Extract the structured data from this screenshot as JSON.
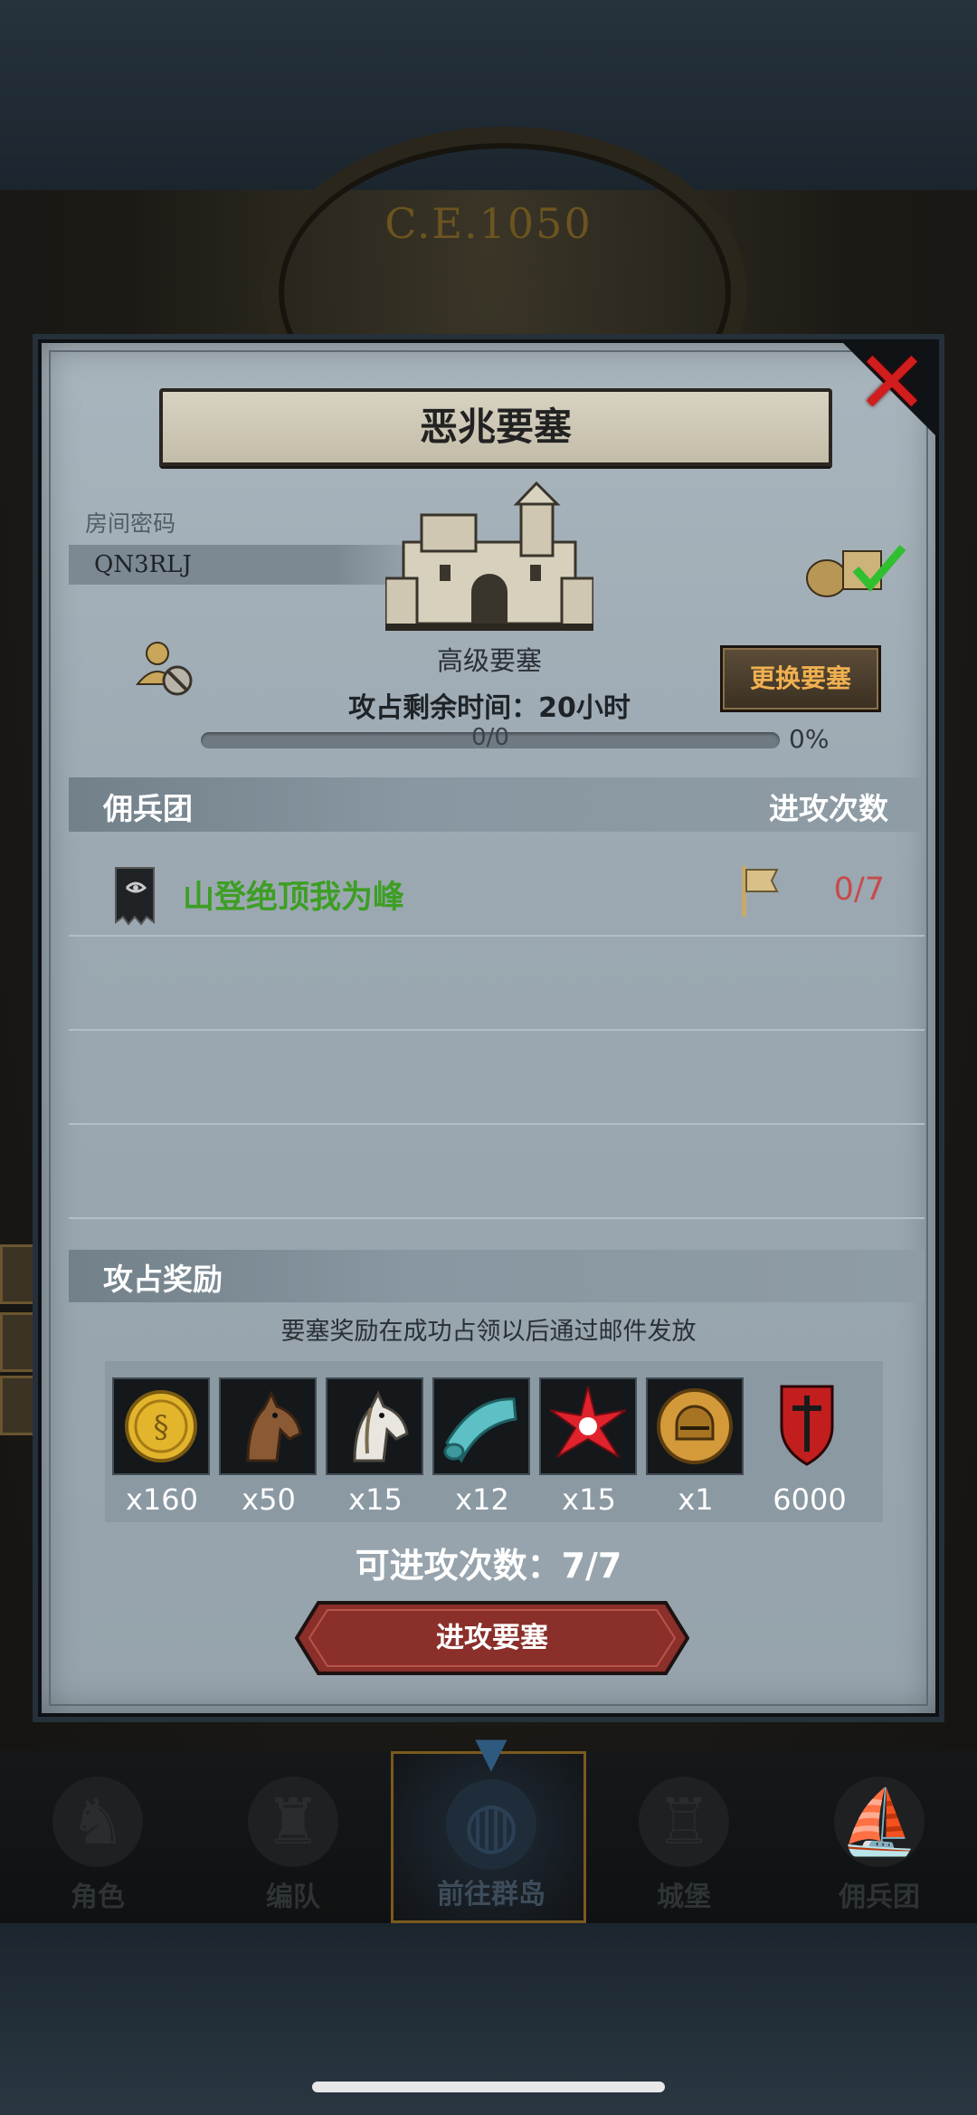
{
  "backdrop": {
    "era": "C.E.1050"
  },
  "dialog": {
    "title": "恶兆要塞",
    "room_label": "房间密码",
    "room_code": "QN3RLJ",
    "fortress_level": "高级要塞",
    "time_left": "攻占剩余时间：20小时",
    "change_fortress": "更换要塞",
    "progress": {
      "text": "0/0",
      "percent_text": "0%",
      "fraction": 0
    },
    "mercenary_header": "佣兵团",
    "attack_count_header": "进攻次数",
    "mercenaries": [
      {
        "name": "山登绝顶我为峰",
        "attacks": "0/7"
      }
    ],
    "reward_header": "攻占奖励",
    "reward_note": "要塞奖励在成功占领以后通过邮件发放",
    "rewards": [
      {
        "icon": "gold-coin-icon",
        "qty": "x160"
      },
      {
        "icon": "brown-horse-icon",
        "qty": "x50"
      },
      {
        "icon": "white-horse-icon",
        "qty": "x15"
      },
      {
        "icon": "cloth-roll-icon",
        "qty": "x12"
      },
      {
        "icon": "red-star-icon",
        "qty": "x15"
      },
      {
        "icon": "helmet-medal-icon",
        "qty": "x1"
      },
      {
        "icon": "sword-shield-icon",
        "qty": "6000"
      }
    ],
    "attacks_available": "可进攻次数：7/7",
    "attack_button": "进攻要塞"
  },
  "bottom_nav": [
    {
      "label": "角色",
      "icon": "knight-icon"
    },
    {
      "label": "编队",
      "icon": "team-icon"
    },
    {
      "label": "前往群岛",
      "icon": "globe-icon",
      "active": true
    },
    {
      "label": "城堡",
      "icon": "castle-icon"
    },
    {
      "label": "佣兵团",
      "icon": "ship-icon"
    }
  ],
  "colors": {
    "merc_name": "#3d9e24",
    "attack_count": "#c84a4a",
    "change_button_text": "#f0b050",
    "close_icon": "#d11d1d"
  }
}
